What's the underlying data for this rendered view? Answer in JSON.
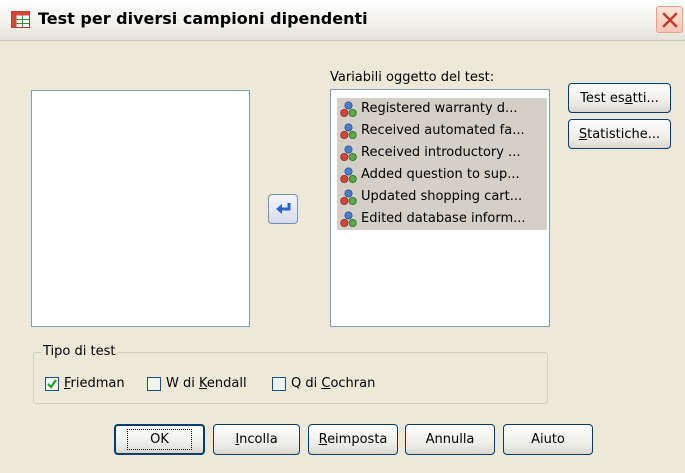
{
  "window": {
    "title": "Test per diversi campioni dipendenti"
  },
  "target_list": {
    "label": "Variabili oggetto del test:",
    "items": [
      {
        "label": "Registered warranty d..."
      },
      {
        "label": "Received automated fa..."
      },
      {
        "label": "Received introductory ..."
      },
      {
        "label": "Added question to sup..."
      },
      {
        "label": "Updated shopping cart..."
      },
      {
        "label": "Edited database inform..."
      }
    ]
  },
  "side_buttons": {
    "exact": {
      "pre": "Test es",
      "key": "a",
      "post": "tti..."
    },
    "stats": {
      "pre": "",
      "key": "S",
      "post": "tatistiche..."
    }
  },
  "test_type": {
    "title": "Tipo di test",
    "options": [
      {
        "pre": "",
        "key": "F",
        "post": "riedman",
        "checked": true
      },
      {
        "pre": "W di ",
        "key": "K",
        "post": "endall",
        "checked": false
      },
      {
        "pre": "Q di ",
        "key": "C",
        "post": "ochran",
        "checked": false
      }
    ]
  },
  "buttons": {
    "ok": {
      "pre": "OK",
      "key": "",
      "post": ""
    },
    "paste": {
      "pre": "",
      "key": "I",
      "post": "ncolla"
    },
    "reset": {
      "pre": "",
      "key": "R",
      "post": "eimposta"
    },
    "cancel": {
      "pre": "Annulla",
      "key": "",
      "post": ""
    },
    "help": {
      "pre": "Aiuto",
      "key": "",
      "post": ""
    }
  },
  "icons": {
    "app": "grid-table-icon",
    "close": "close-icon",
    "move": "arrow-left-icon",
    "variable": "nominal-variable-icon"
  },
  "colors": {
    "accent": "#003c74",
    "selection": "#d4d0c8",
    "close": "#d3552f"
  }
}
